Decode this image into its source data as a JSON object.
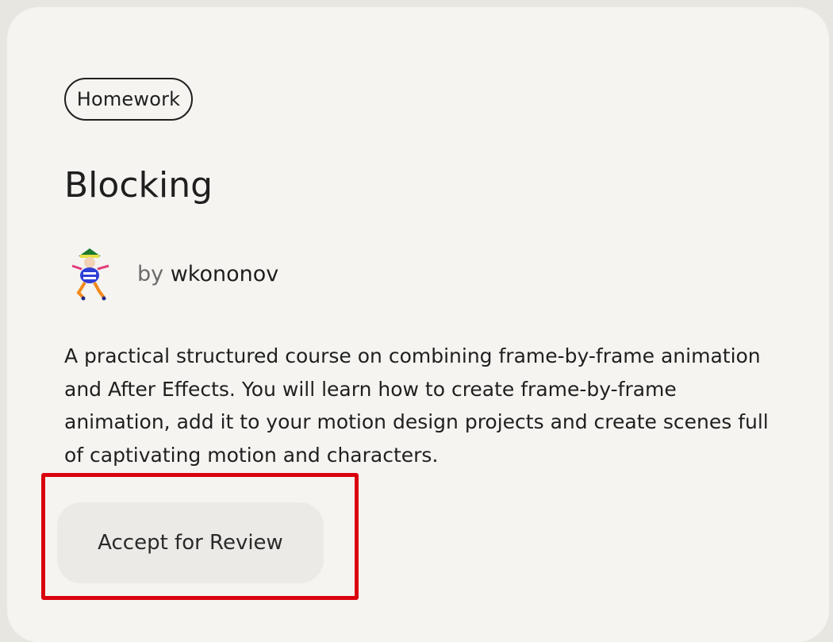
{
  "card": {
    "tag": "Homework",
    "title": "Blocking",
    "author": {
      "by_word": "by",
      "name": "wkononov",
      "avatar_icon": "character-avatar-icon"
    },
    "description": "A practical structured course on combining frame-by-frame animation and After Effects. You will learn how to create frame-by-frame animation, add it to your motion design projects and create scenes full of captivating motion and characters.",
    "accept_button_label": "Accept for Review"
  },
  "colors": {
    "page_background": "#e8e6e1",
    "card_background": "#f5f4f1",
    "button_background": "#ebeae6",
    "highlight_border": "#d9000d",
    "text": "#1f1f1f"
  }
}
